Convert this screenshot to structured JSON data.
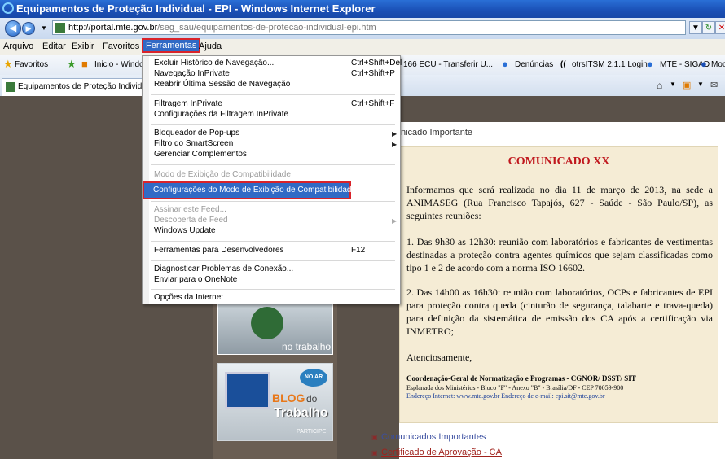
{
  "window": {
    "title": "Equipamentos de Proteção Individual - EPI - Windows Internet Explorer"
  },
  "address": {
    "host": "http://portal.mte.gov.br",
    "path": "/seg_sau/equipamentos-de-protecao-individual-epi.htm"
  },
  "menubar": [
    "Arquivo",
    "Editar",
    "Exibir",
    "Favoritos",
    "Ferramentas",
    "Ajuda"
  ],
  "favbar": {
    "favorites": "Favoritos",
    "inicio": "Inicio - Windo",
    "items": [
      "166 ECU - Transferir U...",
      "Denúncias",
      "otrsITSM 2.1.1 Login",
      "MTE - SIGAD",
      "Moodle"
    ]
  },
  "tab": {
    "title": "Equipamentos de Proteção Individua"
  },
  "menu": {
    "items": [
      {
        "label": "Excluir Histórico de Navegação...",
        "shortcut": "Ctrl+Shift+Del"
      },
      {
        "label": "Navegação InPrivate",
        "shortcut": "Ctrl+Shift+P"
      },
      {
        "label": "Reabrir Última Sessão de Navegação",
        "shortcut": ""
      },
      {
        "label": "Filtragem InPrivate",
        "shortcut": "Ctrl+Shift+F"
      },
      {
        "label": "Configurações da Filtragem InPrivate",
        "shortcut": ""
      },
      {
        "label": "Bloqueador de Pop-ups",
        "shortcut": ""
      },
      {
        "label": "Filtro do SmartScreen",
        "shortcut": ""
      },
      {
        "label": "Gerenciar Complementos",
        "shortcut": ""
      },
      {
        "label": "Modo de Exibição de Compatibilidade",
        "shortcut": ""
      },
      {
        "label": "Configurações do Modo de Exibição de Compatibilidade",
        "shortcut": ""
      },
      {
        "label": "Assinar este Feed...",
        "shortcut": ""
      },
      {
        "label": "Descoberta de Feed",
        "shortcut": ""
      },
      {
        "label": "Windows Update",
        "shortcut": ""
      },
      {
        "label": "Ferramentas para Desenvolvedores",
        "shortcut": "F12"
      },
      {
        "label": "Diagnosticar Problemas de Conexão...",
        "shortcut": ""
      },
      {
        "label": "Enviar para o OneNote",
        "shortcut": ""
      },
      {
        "label": "Opções da Internet",
        "shortcut": ""
      }
    ]
  },
  "page": {
    "header": "nicado Importante",
    "title": "COMUNICADO XX",
    "p1": "Informamos que será realizada no dia 11 de março de 2013, na sede a ANIMASEG (Rua Francisco Tapajós, 627 - Saúde - São Paulo/SP), as seguintes reuniões:",
    "p2": "1. Das 9h30 as 12h30: reunião com laboratórios e fabricantes de vestimentas destinadas a proteção contra agentes químicos que sejam classificadas como tipo 1 e 2 de acordo com a norma ISO 16602.",
    "p3": "2. Das 14h00 as 16h30: reunião com laboratórios, OCPs e fabricantes de EPI para proteção contra queda (cinturão de segurança, talabarte e trava-queda) para definição da sistemática de emissão dos CA após a certificação via INMETRO;",
    "closing": "Atenciosamente,",
    "sig_title": "Coordenação-Geral de Normatização e Programas - CGNOR/ DSST/ SIT",
    "sig_line2": "Esplanada dos Ministérios - Bloco \"F\" - Anexo \"B\" - Brasília/DF - CEP 70059-900",
    "sig_line3": "Endereço Internet: www.mte.gov.br   Endereço de e-mail: epi.sit@mte.gov.br",
    "links": [
      "Comunicados Importantes",
      "Certificado de Aprovação - CA"
    ]
  },
  "promo": {
    "p1_caption": "no trabalho",
    "p2_badge": "NO AR",
    "p2_blog": "BLOG",
    "p2_do": "do",
    "p2_trabalho": "Trabalho",
    "p2_participe": "PARTICIPE"
  }
}
